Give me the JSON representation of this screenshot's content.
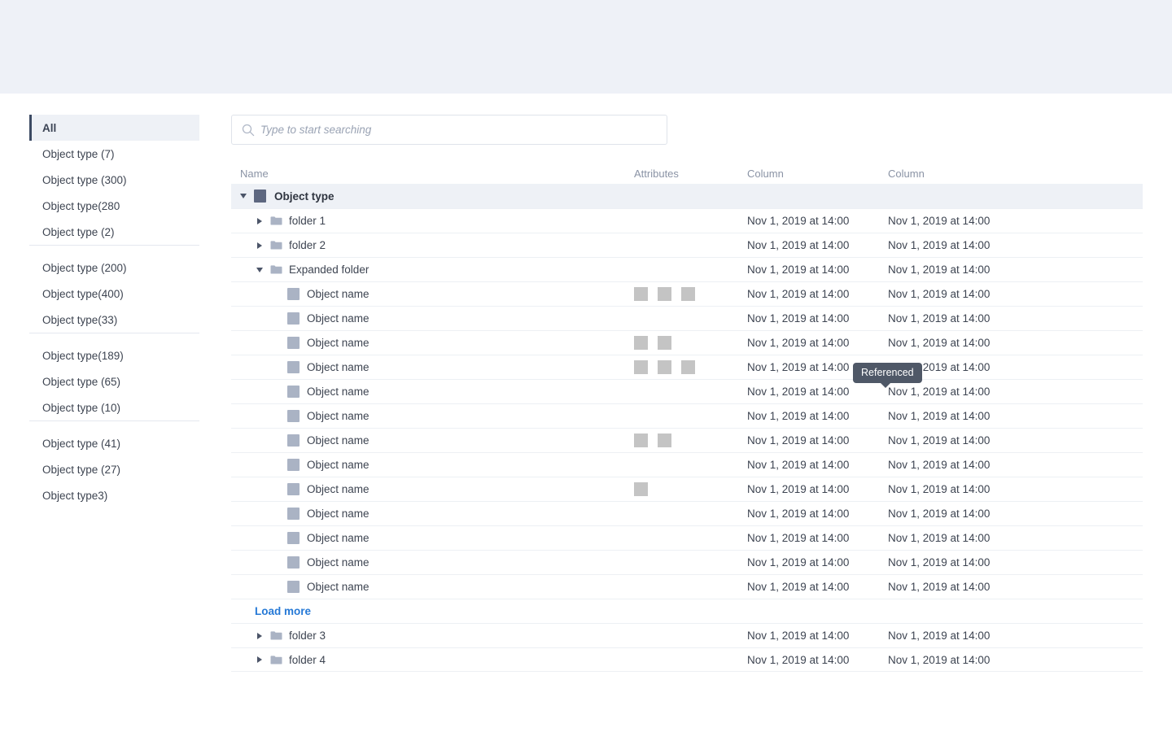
{
  "topbar": {
    "present": true
  },
  "sidebar": {
    "items": [
      {
        "label": "All",
        "active": true,
        "divider_after": false
      },
      {
        "label": "Object type  (7)",
        "active": false,
        "divider_after": false
      },
      {
        "label": "Object type (300)",
        "active": false,
        "divider_after": false
      },
      {
        "label": "Object type(280",
        "active": false,
        "divider_after": false
      },
      {
        "label": "Object type (2)",
        "active": false,
        "divider_after": true
      },
      {
        "label": "Object type (200)",
        "active": false,
        "divider_after": false
      },
      {
        "label": "Object type(400)",
        "active": false,
        "divider_after": false
      },
      {
        "label": "Object type(33)",
        "active": false,
        "divider_after": true
      },
      {
        "label": "Object type(189)",
        "active": false,
        "divider_after": false
      },
      {
        "label": "Object type (65)",
        "active": false,
        "divider_after": false
      },
      {
        "label": "Object type (10)",
        "active": false,
        "divider_after": true
      },
      {
        "label": "Object type (41)",
        "active": false,
        "divider_after": false
      },
      {
        "label": "Object type (27)",
        "active": false,
        "divider_after": false
      },
      {
        "label": "Object type3)",
        "active": false,
        "divider_after": false
      }
    ]
  },
  "search": {
    "value": "",
    "placeholder": "Type to start searching",
    "icon": "search-icon"
  },
  "tooltip": {
    "text": "Referenced"
  },
  "table": {
    "columns": {
      "name": "Name",
      "attributes": "Attributes",
      "column1": "Column",
      "column2": "Column"
    },
    "rows": [
      {
        "kind": "group",
        "indent": 0,
        "chevron": "down",
        "icon": "group-icon",
        "label": "Object type",
        "attributes": 0,
        "column1": "",
        "column2": ""
      },
      {
        "kind": "folder",
        "indent": 1,
        "chevron": "right",
        "icon": "folder-icon",
        "label": "folder 1",
        "attributes": 0,
        "column1": "Nov 1, 2019 at 14:00",
        "column2": "Nov 1, 2019 at 14:00"
      },
      {
        "kind": "folder",
        "indent": 1,
        "chevron": "right",
        "icon": "folder-icon",
        "label": "folder 2",
        "attributes": 0,
        "column1": "Nov 1, 2019 at 14:00",
        "column2": "Nov 1, 2019 at 14:00"
      },
      {
        "kind": "folder",
        "indent": 1,
        "chevron": "down",
        "icon": "folder-icon",
        "label": "Expanded folder",
        "attributes": 0,
        "column1": "Nov 1, 2019 at 14:00",
        "column2": "Nov 1, 2019 at 14:00"
      },
      {
        "kind": "object",
        "indent": 2,
        "chevron": "none",
        "icon": "object-icon",
        "label": "Object name",
        "attributes": 3,
        "column1": "Nov 1, 2019 at 14:00",
        "column2": "Nov 1, 2019 at 14:00"
      },
      {
        "kind": "object",
        "indent": 2,
        "chevron": "none",
        "icon": "object-icon",
        "label": "Object name",
        "attributes": 0,
        "column1": "Nov 1, 2019 at 14:00",
        "column2": "Nov 1, 2019 at 14:00"
      },
      {
        "kind": "object",
        "indent": 2,
        "chevron": "none",
        "icon": "object-icon",
        "label": "Object name",
        "attributes": 2,
        "column1": "Nov 1, 2019 at 14:00",
        "column2": "Nov 1, 2019 at 14:00"
      },
      {
        "kind": "object",
        "indent": 2,
        "chevron": "none",
        "icon": "object-icon",
        "label": "Object name",
        "attributes": 3,
        "column1": "Nov 1, 2019 at 14:00",
        "column2": "Nov 1, 2019 at 14:00"
      },
      {
        "kind": "object",
        "indent": 2,
        "chevron": "none",
        "icon": "object-icon",
        "label": "Object name",
        "attributes": 0,
        "column1": "Nov 1, 2019 at 14:00",
        "column2": "Nov 1, 2019 at 14:00"
      },
      {
        "kind": "object",
        "indent": 2,
        "chevron": "none",
        "icon": "object-icon",
        "label": "Object name",
        "attributes": 0,
        "column1": "Nov 1, 2019 at 14:00",
        "column2": "Nov 1, 2019 at 14:00"
      },
      {
        "kind": "object",
        "indent": 2,
        "chevron": "none",
        "icon": "object-icon",
        "label": "Object name",
        "attributes": 2,
        "column1": "Nov 1, 2019 at 14:00",
        "column2": "Nov 1, 2019 at 14:00"
      },
      {
        "kind": "object",
        "indent": 2,
        "chevron": "none",
        "icon": "object-icon",
        "label": "Object name",
        "attributes": 0,
        "column1": "Nov 1, 2019 at 14:00",
        "column2": "Nov 1, 2019 at 14:00"
      },
      {
        "kind": "object",
        "indent": 2,
        "chevron": "none",
        "icon": "object-icon",
        "label": "Object name",
        "attributes": 1,
        "column1": "Nov 1, 2019 at 14:00",
        "column2": "Nov 1, 2019 at 14:00"
      },
      {
        "kind": "object",
        "indent": 2,
        "chevron": "none",
        "icon": "object-icon",
        "label": "Object name",
        "attributes": 0,
        "column1": "Nov 1, 2019 at 14:00",
        "column2": "Nov 1, 2019 at 14:00"
      },
      {
        "kind": "object",
        "indent": 2,
        "chevron": "none",
        "icon": "object-icon",
        "label": "Object name",
        "attributes": 0,
        "column1": "Nov 1, 2019 at 14:00",
        "column2": "Nov 1, 2019 at 14:00"
      },
      {
        "kind": "object",
        "indent": 2,
        "chevron": "none",
        "icon": "object-icon",
        "label": "Object name",
        "attributes": 0,
        "column1": "Nov 1, 2019 at 14:00",
        "column2": "Nov 1, 2019 at 14:00"
      },
      {
        "kind": "object",
        "indent": 2,
        "chevron": "none",
        "icon": "object-icon",
        "label": "Object name",
        "attributes": 0,
        "column1": "Nov 1, 2019 at 14:00",
        "column2": "Nov 1, 2019 at 14:00"
      },
      {
        "kind": "loadmore",
        "indent": 0,
        "chevron": "none",
        "icon": "none",
        "label": "Load more",
        "attributes": 0,
        "column1": "",
        "column2": ""
      },
      {
        "kind": "folder",
        "indent": 1,
        "chevron": "right",
        "icon": "folder-icon",
        "label": "folder 3",
        "attributes": 0,
        "column1": "Nov 1, 2019 at 14:00",
        "column2": "Nov 1, 2019 at 14:00"
      },
      {
        "kind": "folder",
        "indent": 1,
        "chevron": "right",
        "icon": "folder-icon",
        "label": "folder 4",
        "attributes": 0,
        "column1": "Nov 1, 2019 at 14:00",
        "column2": "Nov 1, 2019 at 14:00"
      }
    ]
  },
  "colors": {
    "topbar_bg": "#eef1f7",
    "group_row_bg": "#eef1f6",
    "accent_link": "#2679d6",
    "sidebar_active_border": "#3c4a63",
    "tooltip_bg": "#4f5867",
    "chip_gray": "#c4c4c4",
    "object_icon": "#aab3c4",
    "folder_icon": "#aab3c4"
  }
}
